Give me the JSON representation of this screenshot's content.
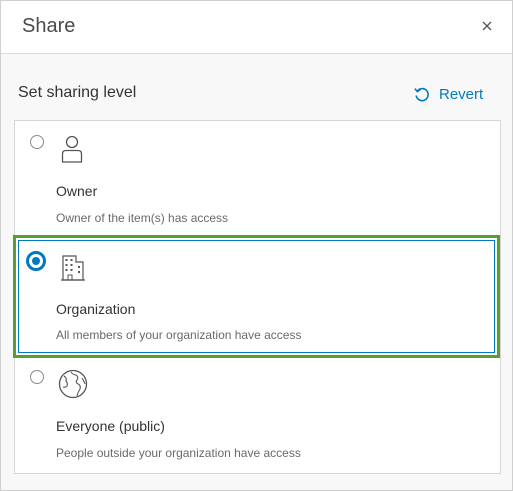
{
  "dialog": {
    "title": "Share",
    "close_icon": "close-icon"
  },
  "sharing": {
    "heading": "Set sharing level",
    "revert_label": "Revert",
    "revert_icon": "revert-icon",
    "selected": "organization",
    "options": [
      {
        "id": "owner",
        "label": "Owner",
        "description": "Owner of the item(s) has access",
        "icon": "person-icon"
      },
      {
        "id": "organization",
        "label": "Organization",
        "description": "All members of your organization have access",
        "icon": "building-icon"
      },
      {
        "id": "everyone",
        "label": "Everyone (public)",
        "description": "People outside your organization have access",
        "icon": "globe-icon"
      }
    ]
  },
  "colors": {
    "accent": "#0079c1",
    "selection_outline": "#5a9e31"
  }
}
